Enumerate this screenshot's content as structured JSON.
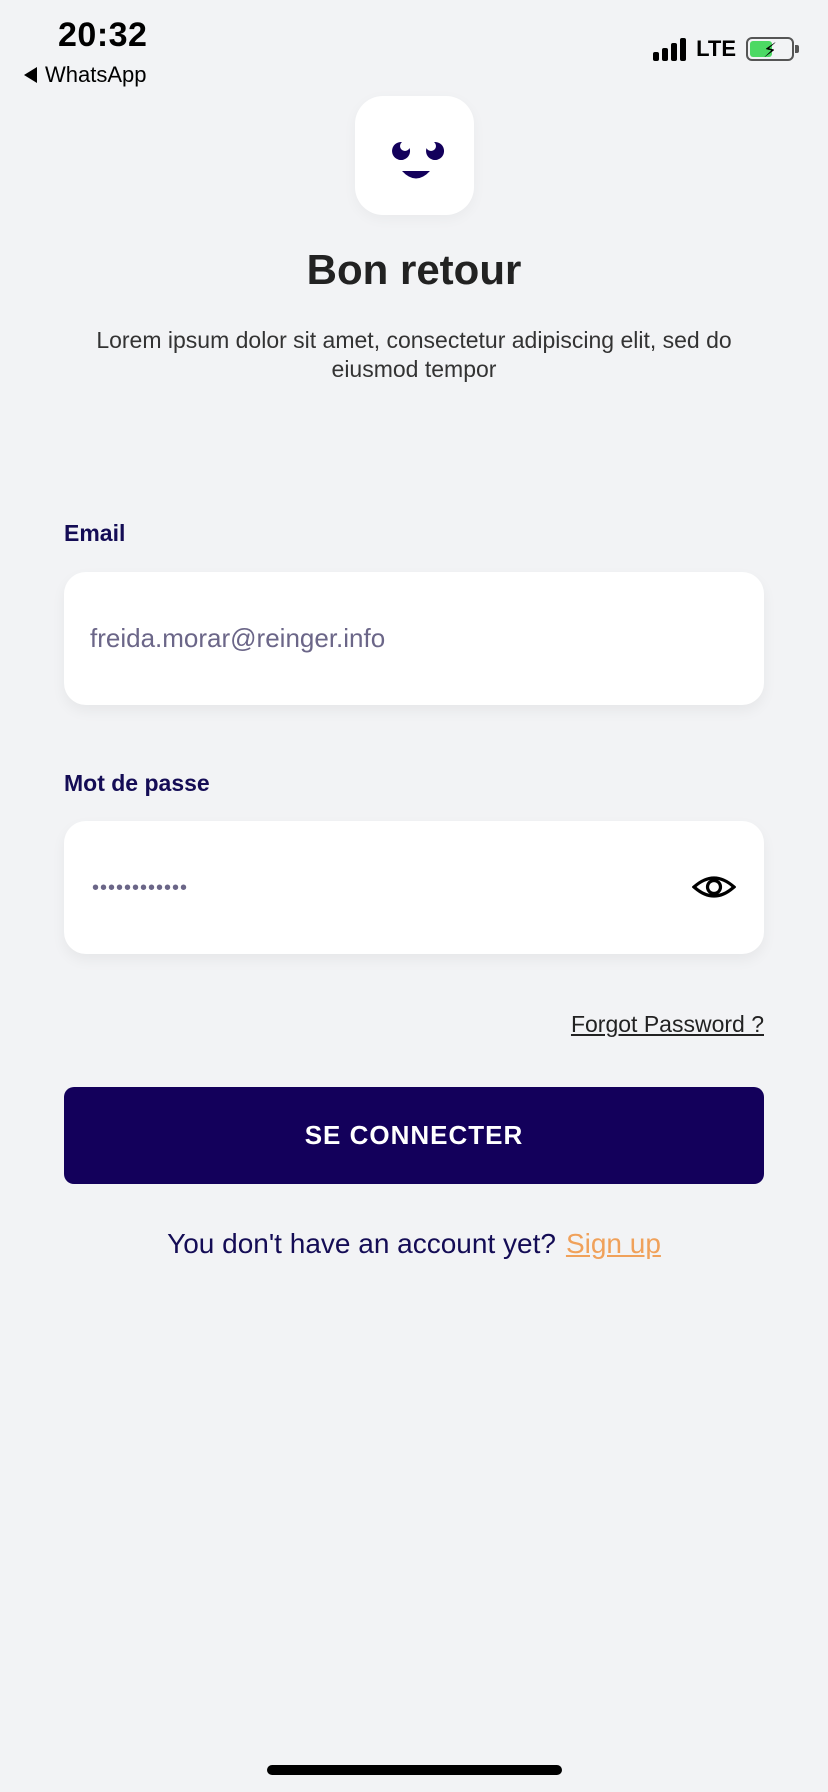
{
  "status_bar": {
    "time": "20:32",
    "back_app": "WhatsApp",
    "network": "LTE",
    "signal_bars": 4,
    "battery_charging": true
  },
  "logo": {
    "icon": "smiley-face-icon"
  },
  "header": {
    "title": "Bon retour",
    "subtitle": "Lorem ipsum dolor sit amet, consectetur adipiscing elit, sed do eiusmod tempor"
  },
  "form": {
    "email_label": "Email",
    "email_value": "freida.morar@reinger.info",
    "password_label": "Mot de passe",
    "password_masked": "••••••••••••",
    "forgot_link": "Forgot Password ?",
    "submit_label": "SE CONNECTER"
  },
  "footer": {
    "prompt": "You don't have an account yet?",
    "signup_link": "Sign up"
  },
  "colors": {
    "background": "#f2f3f5",
    "primary": "#13005b",
    "accent": "#f0a15a",
    "label": "#140c55"
  }
}
